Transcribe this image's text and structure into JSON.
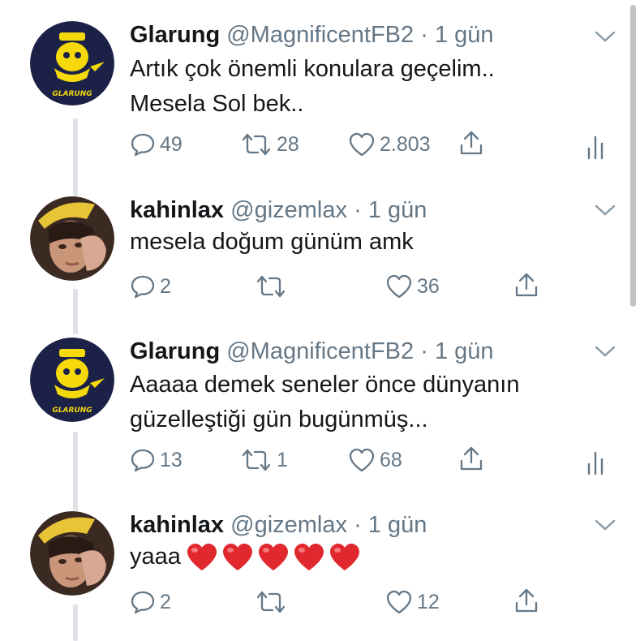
{
  "tweets": [
    {
      "author": "Glarung",
      "handle": "@MagnificentFB2",
      "sep": "·",
      "time": "1 gün",
      "lines": [
        "Artık çok önemli konulara geçelim..",
        "Mesela Sol bek.."
      ],
      "reply_count": "49",
      "retweet_count": "28",
      "like_count": "2.803",
      "avatar": "glarung-avatar",
      "show_analytics": true
    },
    {
      "author": "kahinlax",
      "handle": "@gizemlax",
      "sep": "·",
      "time": "1 gün",
      "lines": [
        "mesela doğum günüm amk"
      ],
      "reply_count": "2",
      "retweet_count": "",
      "like_count": "36",
      "avatar": "kahinlax-avatar",
      "show_analytics": false
    },
    {
      "author": "Glarung",
      "handle": "@MagnificentFB2",
      "sep": "·",
      "time": "1 gün",
      "lines": [
        "Aaaaa demek seneler önce dünyanın",
        "güzelleştiği gün bugünmüş..."
      ],
      "reply_count": "13",
      "retweet_count": "1",
      "like_count": "68",
      "avatar": "glarung-avatar",
      "show_analytics": true
    },
    {
      "author": "kahinlax",
      "handle": "@gizemlax",
      "sep": "·",
      "time": "1 gün",
      "lines": [
        "yaaa"
      ],
      "emoji": [
        "red-heart",
        "red-heart",
        "red-heart",
        "red-heart",
        "red-heart"
      ],
      "reply_count": "2",
      "retweet_count": "",
      "like_count": "12",
      "avatar": "kahinlax-avatar",
      "show_analytics": false
    }
  ],
  "colors": {
    "text": "#14171a",
    "secondary": "#657786",
    "thread_line": "#dfe3e7",
    "glarung_bg": "#1c2148",
    "glarung_yellow": "#f5d90a",
    "heart": "#e0282e"
  }
}
